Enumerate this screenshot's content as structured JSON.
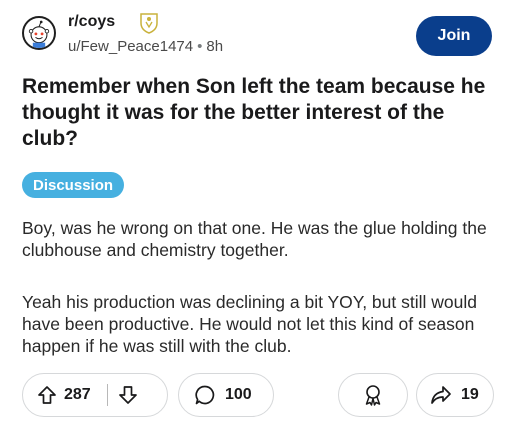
{
  "post": {
    "subreddit": "r/coys",
    "author": "u/Few_Peace1474",
    "separator": "•",
    "age": "8h",
    "join_label": "Join",
    "title": "Remember when Son left the team because he thought it was for the better interest of the club?",
    "flair": "Discussion",
    "body": [
      "Boy, was he wrong on that one. He was the glue holding the clubhouse and chemistry together.",
      "Yeah his production was declining a bit YOY, but still would have been productive. He would not let this kind of season happen if he was still with the club."
    ]
  },
  "actions": {
    "upvote_icon": "arrow-up-icon",
    "score": "287",
    "downvote_icon": "arrow-down-icon",
    "comment_icon": "comment-bubble-icon",
    "comments": "100",
    "award_icon": "award-icon",
    "share_icon": "share-arrow-icon",
    "shares": "19"
  },
  "colors": {
    "join_button": "#0a3e8c",
    "flair_bg": "#46b0e0",
    "pill_border": "#d6d8da",
    "text": "#1a1a1b"
  }
}
